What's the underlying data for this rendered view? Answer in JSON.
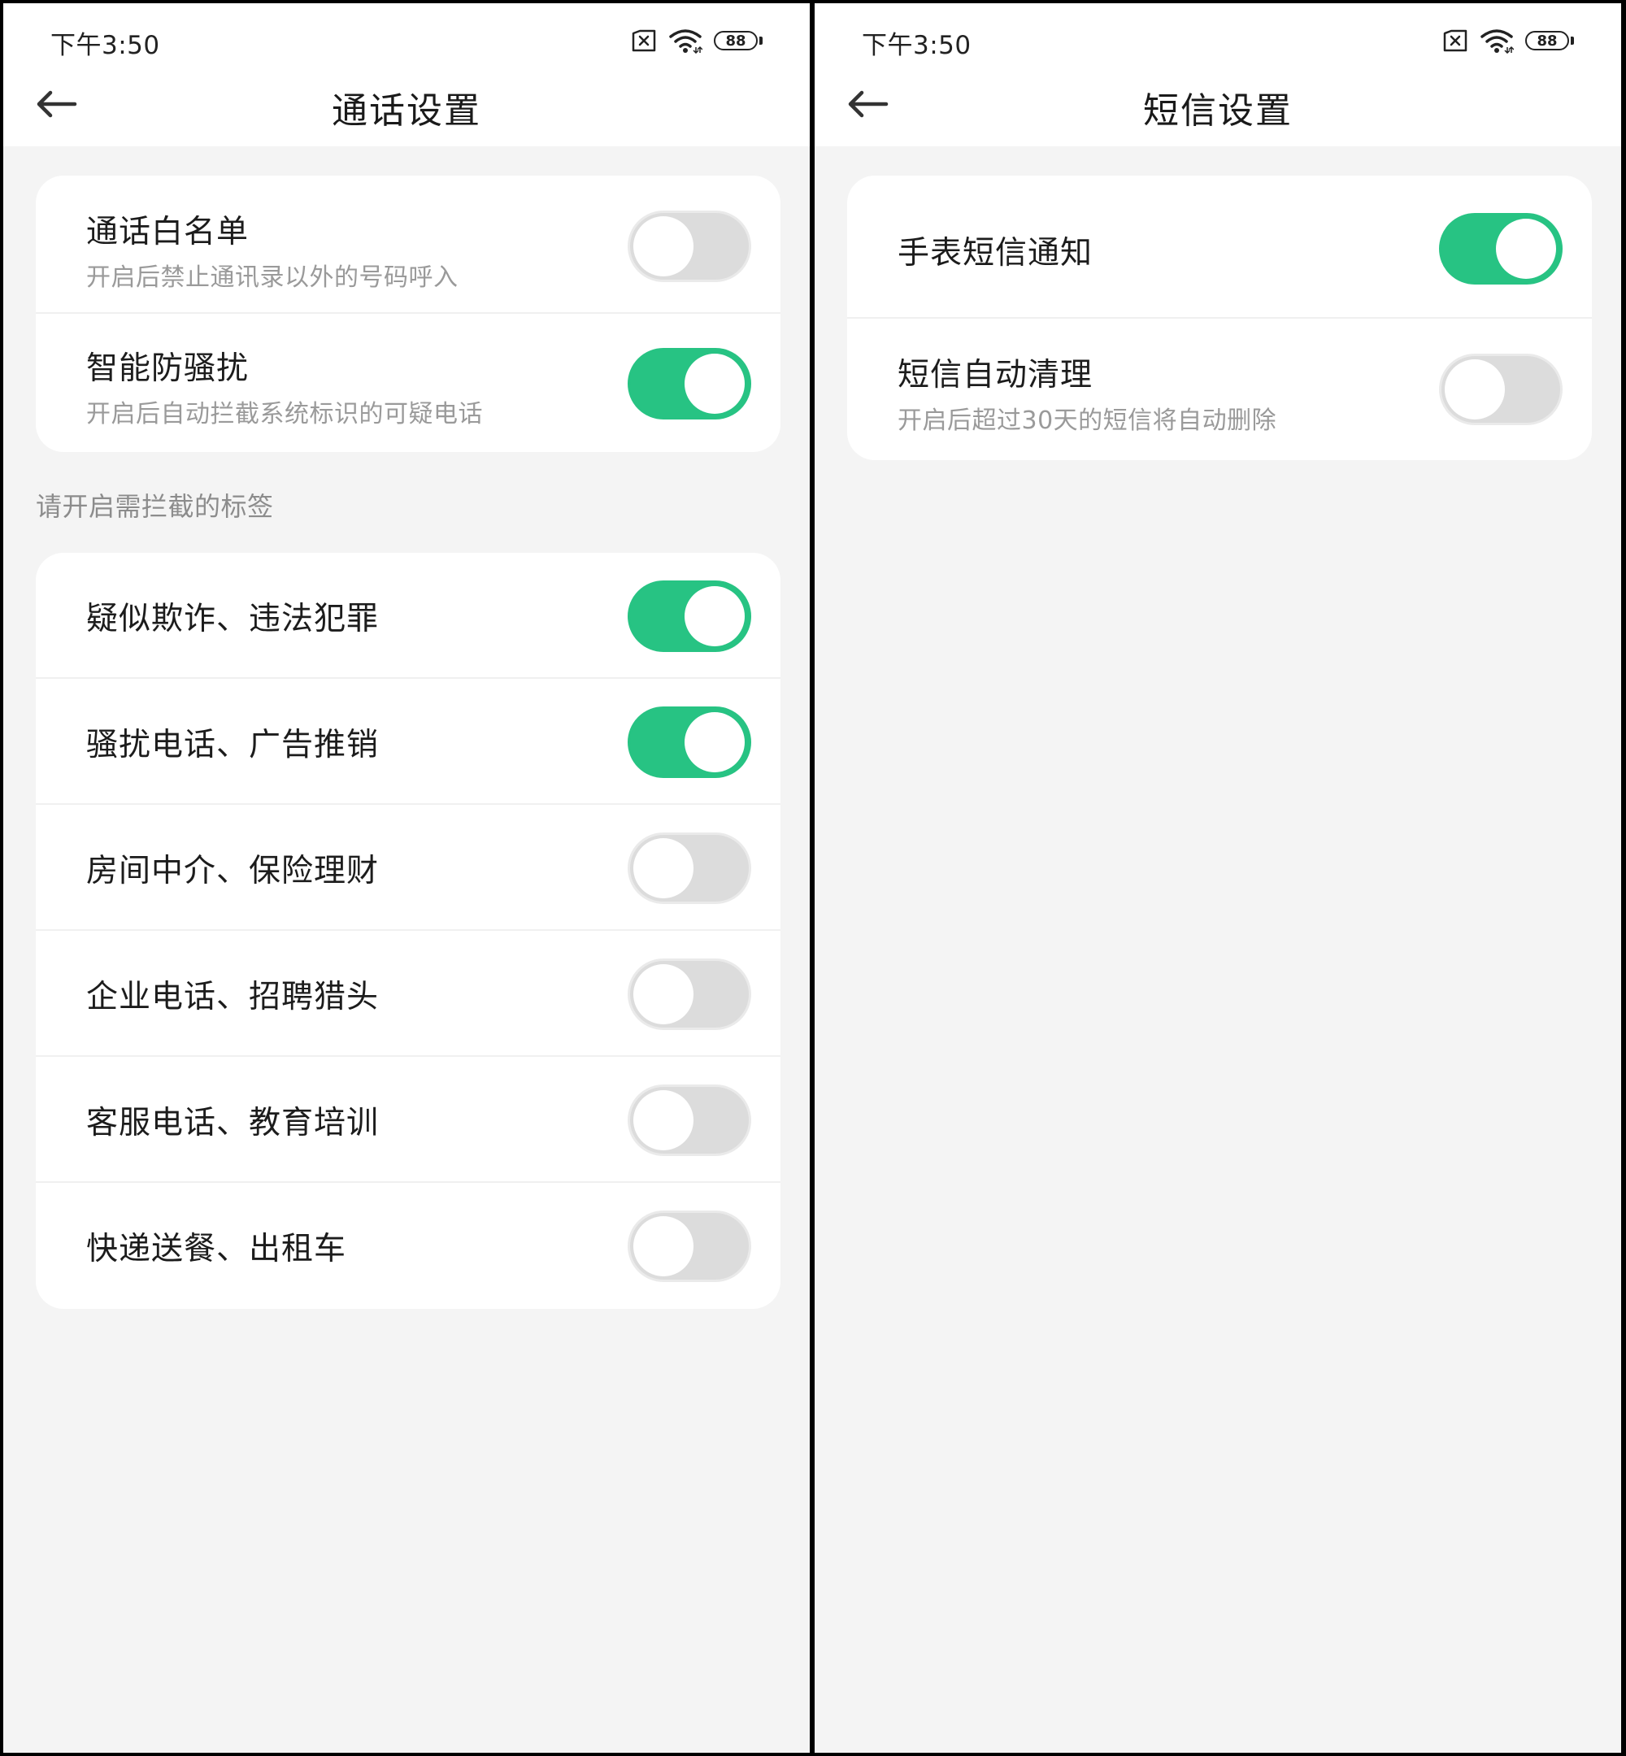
{
  "left_screen": {
    "status_bar": {
      "time": "下午3:50",
      "battery": "88"
    },
    "title": "通话设置",
    "top_card": [
      {
        "label": "通话白名单",
        "sublabel": "开启后禁止通讯录以外的号码呼入",
        "on": false
      },
      {
        "label": "智能防骚扰",
        "sublabel": "开启后自动拦截系统标识的可疑电话",
        "on": true
      }
    ],
    "section_label": "请开启需拦截的标签",
    "tags": [
      {
        "label": "疑似欺诈、违法犯罪",
        "on": true
      },
      {
        "label": "骚扰电话、广告推销",
        "on": true
      },
      {
        "label": "房间中介、保险理财",
        "on": false
      },
      {
        "label": "企业电话、招聘猎头",
        "on": false
      },
      {
        "label": "客服电话、教育培训",
        "on": false
      },
      {
        "label": "快递送餐、出租车",
        "on": false
      }
    ]
  },
  "right_screen": {
    "status_bar": {
      "time": "下午3:50",
      "battery": "88"
    },
    "title": "短信设置",
    "card": [
      {
        "label": "手表短信通知",
        "on": true
      },
      {
        "label": "短信自动清理",
        "sublabel": "开启后超过30天的短信将自动删除",
        "on": false
      }
    ]
  },
  "colors": {
    "toggle_on": "#27c383",
    "toggle_off": "#dcdcdc",
    "page_bg": "#f4f4f4"
  },
  "icons": [
    "sim-missing-icon",
    "wifi-icon",
    "battery-icon",
    "back-arrow-icon"
  ]
}
